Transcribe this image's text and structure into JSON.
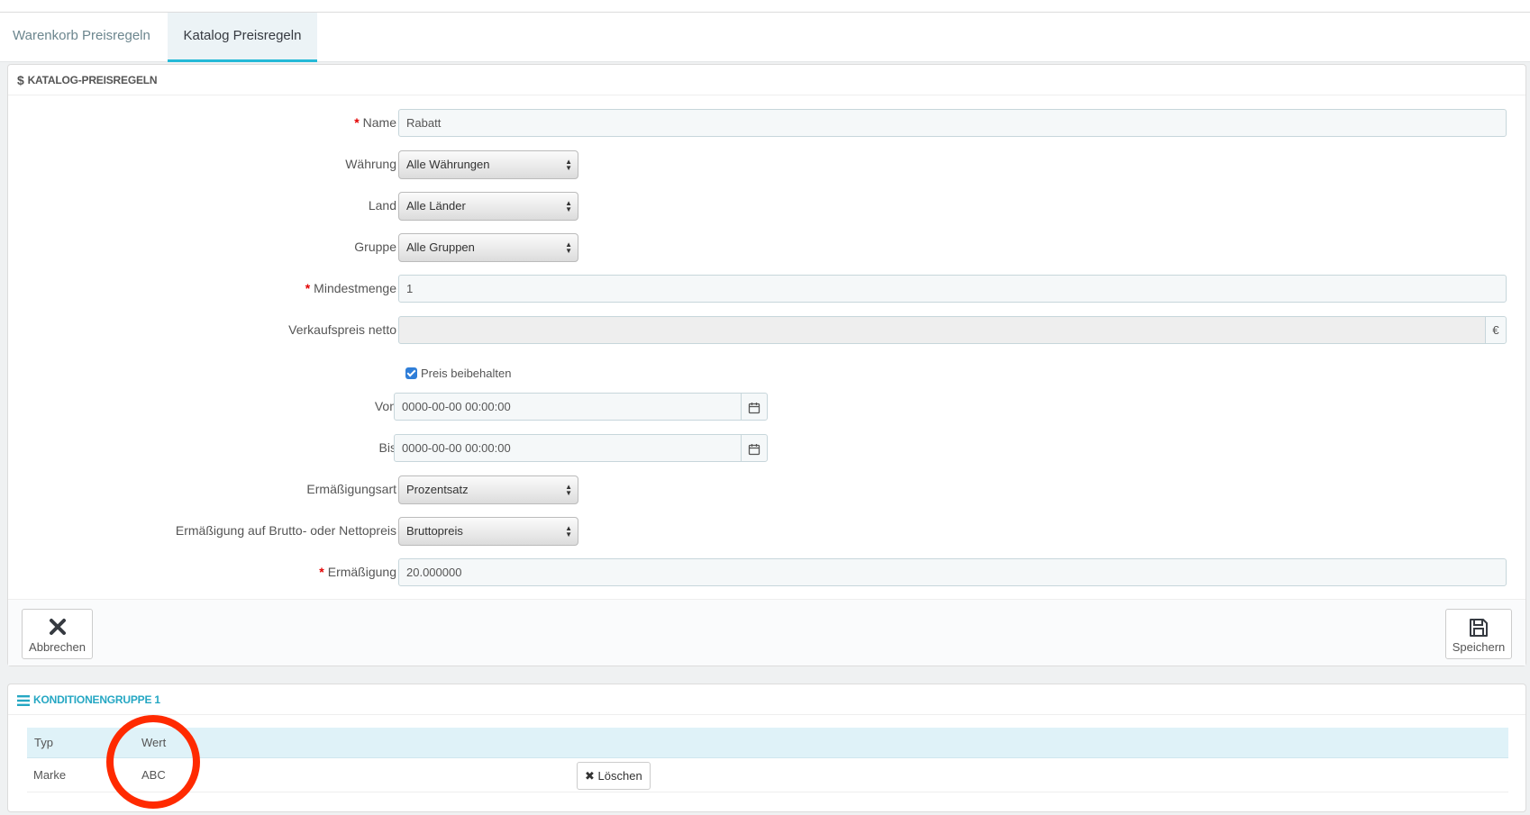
{
  "tabs": [
    {
      "label": "Warenkorb Preisregeln"
    },
    {
      "label": "Katalog Preisregeln"
    }
  ],
  "panel": {
    "title": "Katalog-Preisregeln",
    "fields": {
      "name": {
        "label": "Name",
        "value": "Rabatt"
      },
      "currency": {
        "label": "Währung",
        "value": "Alle Währungen"
      },
      "country": {
        "label": "Land",
        "value": "Alle Länder"
      },
      "group": {
        "label": "Gruppe",
        "value": "Alle Gruppen"
      },
      "min_qty": {
        "label": "Mindestmenge",
        "value": "1"
      },
      "price_net": {
        "label": "Verkaufspreis netto",
        "value": "",
        "addon": "€"
      },
      "keep_price": {
        "label": "Preis beibehalten",
        "checked": true
      },
      "from": {
        "label": "Von",
        "value": "0000-00-00 00:00:00"
      },
      "to": {
        "label": "Bis",
        "value": "0000-00-00 00:00:00"
      },
      "reduction_type": {
        "label": "Ermäßigungsart",
        "value": "Prozentsatz"
      },
      "reduction_tax": {
        "label": "Ermäßigung auf Brutto- oder Nettopreis",
        "value": "Bruttopreis"
      },
      "reduction": {
        "label": "Ermäßigung",
        "value": "20.000000"
      }
    },
    "buttons": {
      "cancel": "Abbrechen",
      "save": "Speichern"
    }
  },
  "conditions": {
    "title": "Konditionengruppe 1",
    "columns": [
      "Typ",
      "Wert"
    ],
    "rows": [
      {
        "type": "Marke",
        "value": "ABC",
        "delete_label": "Löschen"
      }
    ]
  },
  "colors": {
    "accent": "#25b9d7",
    "required": "#e30000",
    "annotation": "#ff2a00"
  }
}
